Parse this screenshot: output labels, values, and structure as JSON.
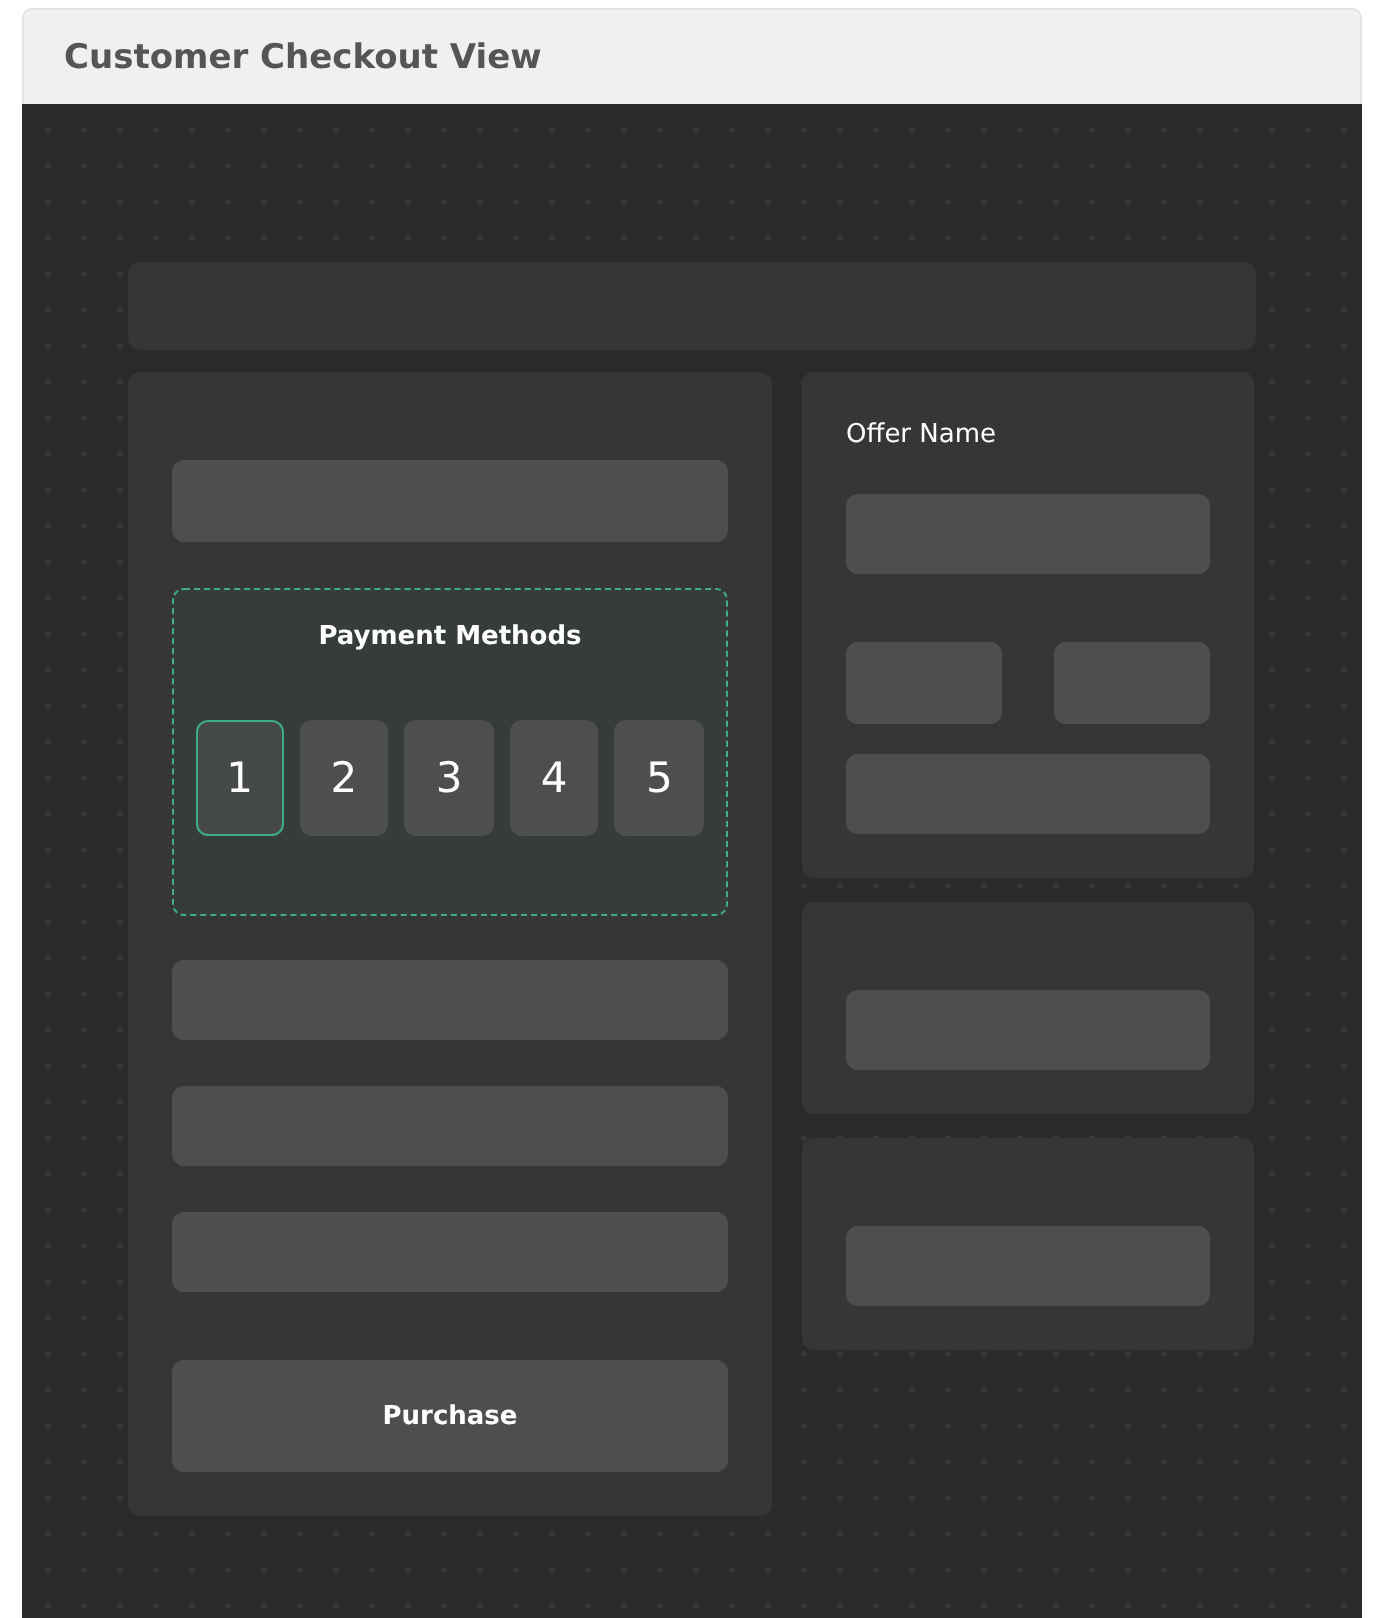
{
  "window": {
    "title": "Customer Checkout View"
  },
  "payment": {
    "title": "Payment Methods",
    "methods": [
      {
        "label": "1",
        "selected": true
      },
      {
        "label": "2",
        "selected": false
      },
      {
        "label": "3",
        "selected": false
      },
      {
        "label": "4",
        "selected": false
      },
      {
        "label": "5",
        "selected": false
      }
    ]
  },
  "purchase_button": {
    "label": "Purchase"
  },
  "offer": {
    "label": "Offer Name"
  }
}
